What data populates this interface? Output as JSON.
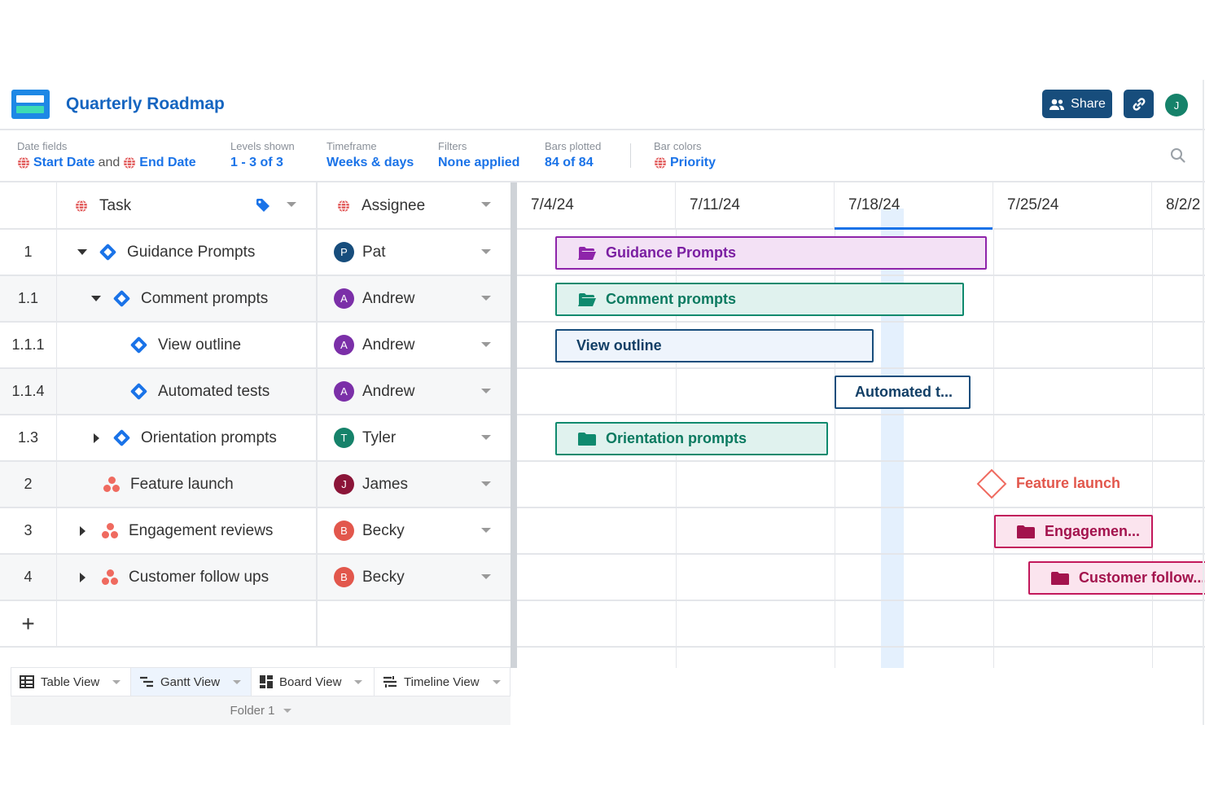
{
  "app": {
    "title": "Quarterly Roadmap",
    "share_label": "Share",
    "user_initial": "J"
  },
  "toolbar": {
    "date_fields": {
      "label": "Date fields",
      "start": "Start Date",
      "and": "and",
      "end": "End Date"
    },
    "levels": {
      "label": "Levels shown",
      "value": "1 - 3 of 3"
    },
    "timeframe": {
      "label": "Timeframe",
      "value": "Weeks & days"
    },
    "filters": {
      "label": "Filters",
      "value": "None applied"
    },
    "bars": {
      "label": "Bars plotted",
      "value": "84 of 84"
    },
    "colors": {
      "label": "Bar colors",
      "value": "Priority"
    }
  },
  "columns": {
    "task": "Task",
    "assignee": "Assignee"
  },
  "rows": [
    {
      "num": "1",
      "task": "Guidance Prompts",
      "assignee": "Pat",
      "initial": "P"
    },
    {
      "num": "1.1",
      "task": "Comment prompts",
      "assignee": "Andrew",
      "initial": "A"
    },
    {
      "num": "1.1.1",
      "task": "View outline",
      "assignee": "Andrew",
      "initial": "A"
    },
    {
      "num": "1.1.4",
      "task": "Automated tests",
      "assignee": "Andrew",
      "initial": "A"
    },
    {
      "num": "1.3",
      "task": "Orientation prompts",
      "assignee": "Tyler",
      "initial": "T"
    },
    {
      "num": "2",
      "task": "Feature launch",
      "assignee": "James",
      "initial": "J"
    },
    {
      "num": "3",
      "task": "Engagement reviews",
      "assignee": "Becky",
      "initial": "B"
    },
    {
      "num": "4",
      "task": "Customer follow ups",
      "assignee": "Becky",
      "initial": "B"
    }
  ],
  "add_row_label": "+",
  "gantt": {
    "dates": [
      "7/4/24",
      "7/11/24",
      "7/18/24",
      "7/25/24",
      "8/2/2"
    ],
    "bars": [
      {
        "label": "Guidance Prompts"
      },
      {
        "label": "Comment prompts"
      },
      {
        "label": "View outline"
      },
      {
        "label": "Automated t..."
      },
      {
        "label": "Orientation prompts"
      },
      {
        "label": "Feature launch"
      },
      {
        "label": "Engagemen..."
      },
      {
        "label": "Customer follow..."
      }
    ]
  },
  "views": [
    {
      "label": "Table View"
    },
    {
      "label": "Gantt View"
    },
    {
      "label": "Board View"
    },
    {
      "label": "Timeline View"
    }
  ],
  "folder": "Folder 1",
  "colors": {
    "brand": "#1e88e5",
    "accent": "#1a73e8",
    "share_bg": "#174d7c",
    "purple_bar": "#8e24aa",
    "teal_bar": "#0f8a6e",
    "navy_bar": "#174d7c",
    "pink_bar": "#c2185b",
    "milestone": "#ef6a5f"
  }
}
